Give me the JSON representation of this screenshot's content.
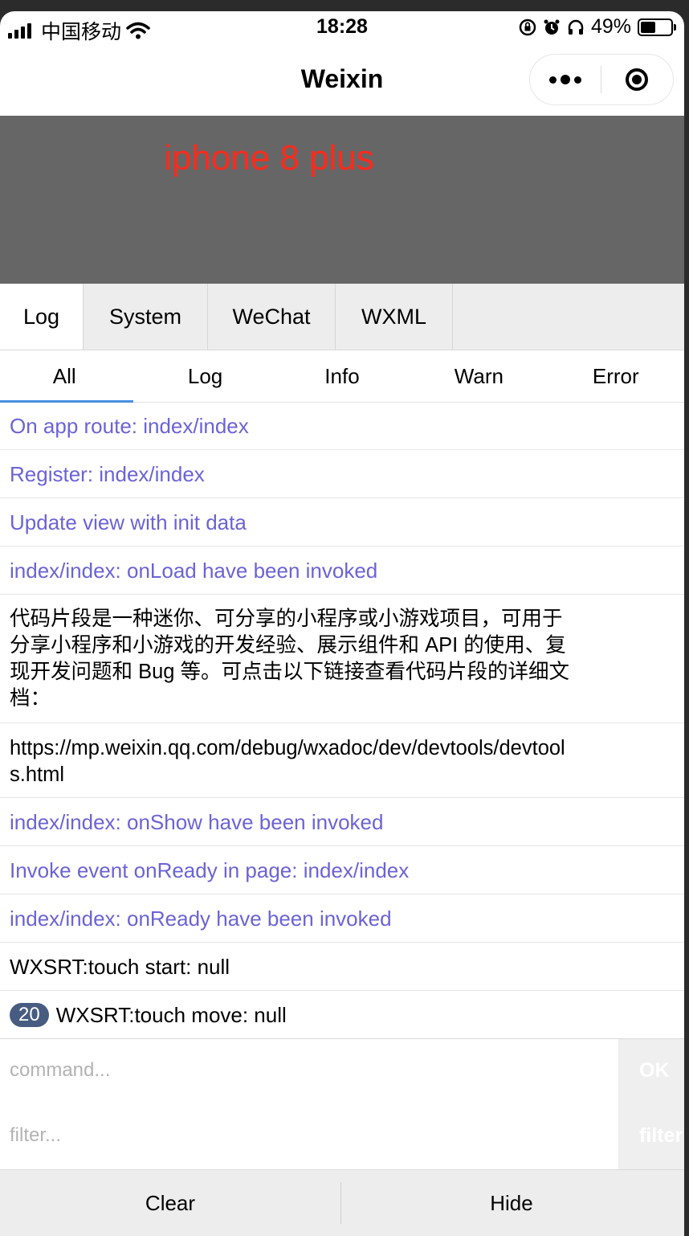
{
  "status_bar": {
    "carrier": "中国移动",
    "time": "18:28",
    "battery_percent": "49%",
    "battery_level": 0.49
  },
  "nav": {
    "title": "Weixin"
  },
  "banner": {
    "text": "iphone 8 plus",
    "text_color": "#ff2a1a",
    "background": "#666666"
  },
  "tabs": [
    "Log",
    "System",
    "WeChat",
    "WXML"
  ],
  "subtabs": [
    "All",
    "Log",
    "Info",
    "Warn",
    "Error"
  ],
  "logs": {
    "route": "On app route: index/index",
    "register": "Register: index/index",
    "update": "Update view with init data",
    "onload": "index/index: onLoad have been invoked",
    "intro": "代码片段是一种迷你、可分享的小程序或小游戏项目，可用于分享小程序和小游戏的开发经验、展示组件和 API 的使用、复现开发问题和 Bug 等。可点击以下链接查看代码片段的详细文档：",
    "url": "https://mp.weixin.qq.com/debug/wxadoc/dev/devtools/devtools.html",
    "onshow": "index/index: onShow have been invoked",
    "invoke": "Invoke event onReady in page: index/index",
    "onready": "index/index: onReady have been invoked",
    "touch_start": "WXSRT:touch start: null",
    "touch_move_count": "20",
    "touch_move": "WXSRT:touch move: null"
  },
  "command": {
    "placeholder": "command...",
    "button": "OK"
  },
  "filter": {
    "placeholder": "filter...",
    "button": "filter"
  },
  "bottom": {
    "clear": "Clear",
    "hide": "Hide"
  },
  "colors": {
    "system_log": "#6b63d6",
    "active_tab_underline": "#4a90e2",
    "badge": "#475c80"
  }
}
